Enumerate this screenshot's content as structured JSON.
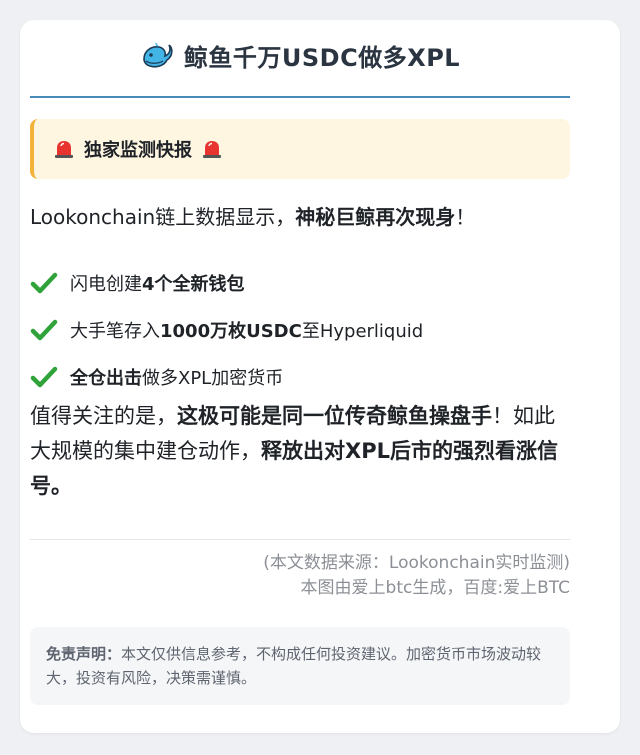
{
  "header": {
    "icon": "whale-icon",
    "title": "鲸鱼千万USDC做多XPL",
    "rule_color": "#4a8cb8"
  },
  "alert": {
    "icon": "siren-icon",
    "label": "独家监测快报"
  },
  "intro": {
    "text": "Lookonchain链上数据显示，",
    "bold": "神秘巨鲸再次现身",
    "end": "！"
  },
  "checklist": [
    {
      "icon": "check-icon",
      "before": "闪电创建",
      "bold": "4个全新钱包",
      "after": ""
    },
    {
      "icon": "check-icon",
      "before": "大手笔存入",
      "bold": "1000万枚USDC",
      "after": "至Hyperliquid"
    },
    {
      "icon": "check-icon",
      "before": "",
      "bold": "全仓出击",
      "after": "做多XPL加密货币"
    }
  ],
  "note": {
    "p1": "值得关注的是，",
    "b1": "这极可能是同一位传奇鲸鱼操盘手",
    "p2": "！如此大规模的集中建仓动作，",
    "b2": "释放出对XPL后市的强烈看涨信号。"
  },
  "source": {
    "line1": "(本文数据来源：Lookonchain实时监测)",
    "line2": "本图由爱上btc生成，百度:爱上BTC"
  },
  "disclaimer": {
    "lead": "免责声明：",
    "text": "本文仅供信息参考，不构成任何投资建议。加密货币市场波动较大，投资有风险，决策需谨慎。"
  },
  "colors": {
    "accent": "#4a8cb8",
    "alert_bg": "#fff6e2",
    "alert_border": "#f3b23a",
    "check_green": "#2fa33a"
  }
}
